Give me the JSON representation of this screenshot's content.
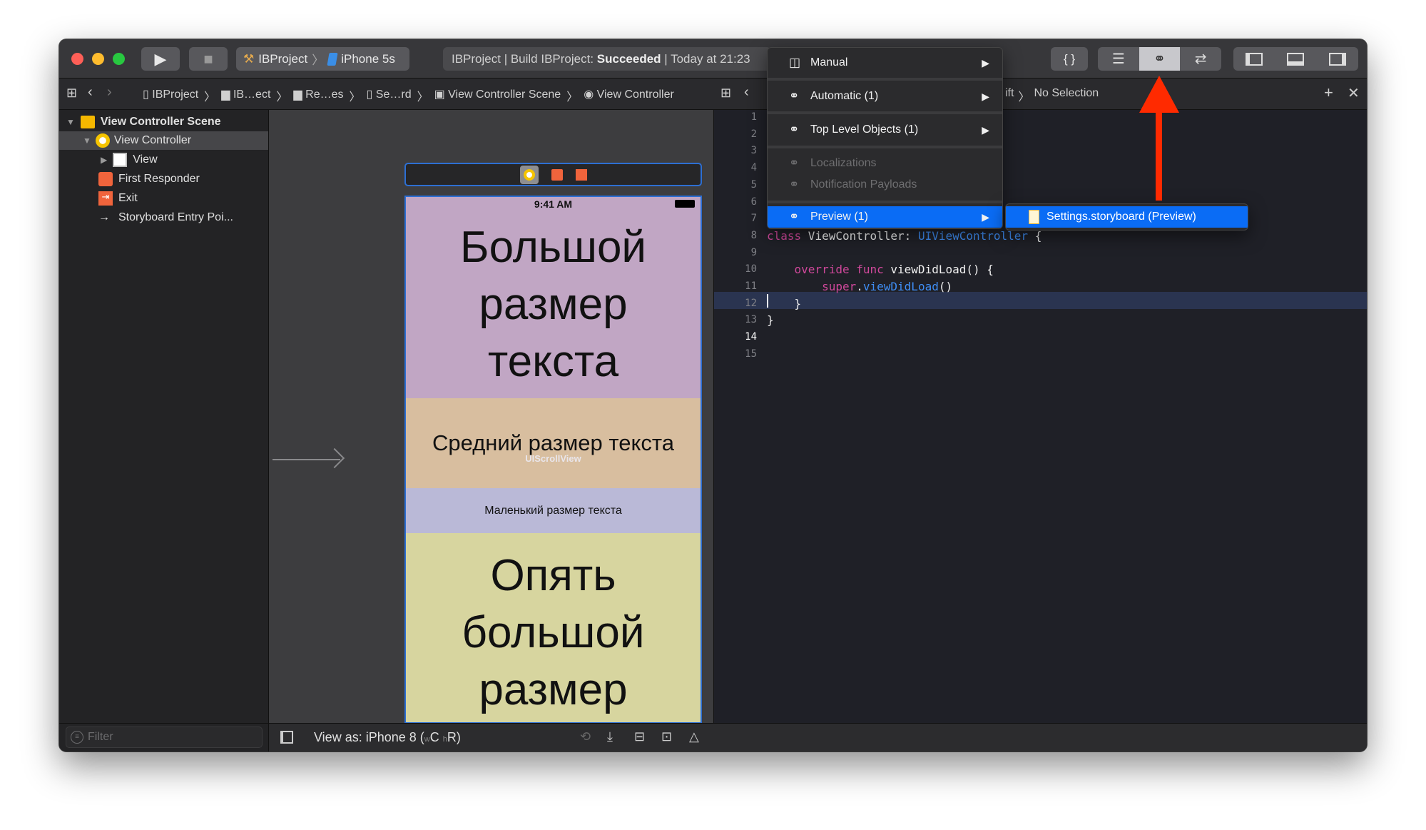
{
  "toolbar": {
    "run_label": "▶",
    "stop_label": "■",
    "scheme": {
      "project": "IBProject",
      "separator": "〉",
      "device": "iPhone 5s"
    },
    "status": {
      "prefix": "IBProject | Build IBProject: ",
      "result": "Succeeded",
      "suffix": " | Today at 21:23"
    },
    "code_review_label": "{ }"
  },
  "breadcrumb": {
    "items": [
      "IBProject",
      "IB…ect",
      "Re…es",
      "Se…rd",
      "View Controller Scene",
      "View Controller"
    ],
    "separator": "〉"
  },
  "assistant_breadcrumb": {
    "file_fragment": "ift",
    "separator": "〉",
    "selection": "No Selection"
  },
  "navigator": {
    "items": [
      {
        "label": "View Controller Scene",
        "level": 0,
        "bold": true
      },
      {
        "label": "View Controller",
        "level": 1,
        "selected": true
      },
      {
        "label": "View",
        "level": 2
      },
      {
        "label": "First Responder",
        "level": 1
      },
      {
        "label": "Exit",
        "level": 1
      },
      {
        "label": "Storyboard Entry Poi...",
        "level": 1
      }
    ],
    "filter_placeholder": "Filter"
  },
  "canvas": {
    "status_time": "9:41 AM",
    "sections": [
      {
        "text": "Большой размер текста",
        "color": "#c1a6c4"
      },
      {
        "text": "Средний размер текста",
        "color": "#d8be9f",
        "overlay": "UIScrollView"
      },
      {
        "text": "Маленький размер текста",
        "color": "#bab9d7"
      },
      {
        "text": "Опять большой размер",
        "color": "#d7d59f"
      }
    ],
    "view_as": {
      "prefix": "View as: iPhone 8 (",
      "w": "w",
      "c": "C",
      "h": "h",
      "r": "R",
      ")": ")"
    }
  },
  "editor": {
    "line_numbers": [
      "1",
      "2",
      "3",
      "4",
      "5",
      "6",
      "7",
      "8",
      "9",
      "10",
      "11",
      "12",
      "13",
      "14",
      "15"
    ],
    "current_line": "14",
    "lines": {
      "8": [
        {
          "t": "class",
          "c": "kw"
        },
        {
          "t": " ViewController: ",
          "c": ""
        },
        {
          "t": "UIViewController",
          "c": "ty"
        },
        {
          "t": " {",
          "c": ""
        }
      ],
      "10": [
        {
          "t": "    ",
          "c": ""
        },
        {
          "t": "override",
          "c": "kw"
        },
        {
          "t": " ",
          "c": ""
        },
        {
          "t": "func",
          "c": "kw"
        },
        {
          "t": " viewDidLoad() {",
          "c": ""
        }
      ],
      "11": [
        {
          "t": "        ",
          "c": ""
        },
        {
          "t": "super",
          "c": "kw"
        },
        {
          "t": ".",
          "c": ""
        },
        {
          "t": "viewDidLoad",
          "c": "fn"
        },
        {
          "t": "()",
          "c": ""
        }
      ],
      "12": [
        {
          "t": "    }",
          "c": ""
        }
      ],
      "13": [
        {
          "t": "}",
          "c": ""
        }
      ]
    }
  },
  "menu": {
    "items": [
      {
        "label": "Manual",
        "icon": "split-columns-icon",
        "arrow": true
      },
      {
        "label": "Automatic (1)",
        "icon": "linked-circles-icon",
        "arrow": true
      },
      {
        "label": "Top Level Objects (1)",
        "icon": "linked-circles-icon",
        "arrow": true
      },
      {
        "label": "Localizations",
        "icon": "linked-circles-icon",
        "disabled": true
      },
      {
        "label": "Notification Payloads",
        "icon": "linked-circles-icon",
        "disabled": true
      },
      {
        "label": "Preview (1)",
        "icon": "linked-circles-icon",
        "arrow": true,
        "highlighted": true
      }
    ],
    "submenu": {
      "label": "Settings.storyboard (Preview)",
      "icon": "storyboard-file-icon"
    }
  },
  "colors": {
    "highlight": "#0a6cf5",
    "annotation_arrow": "#ff2a00",
    "toolbar": "#37373a"
  }
}
